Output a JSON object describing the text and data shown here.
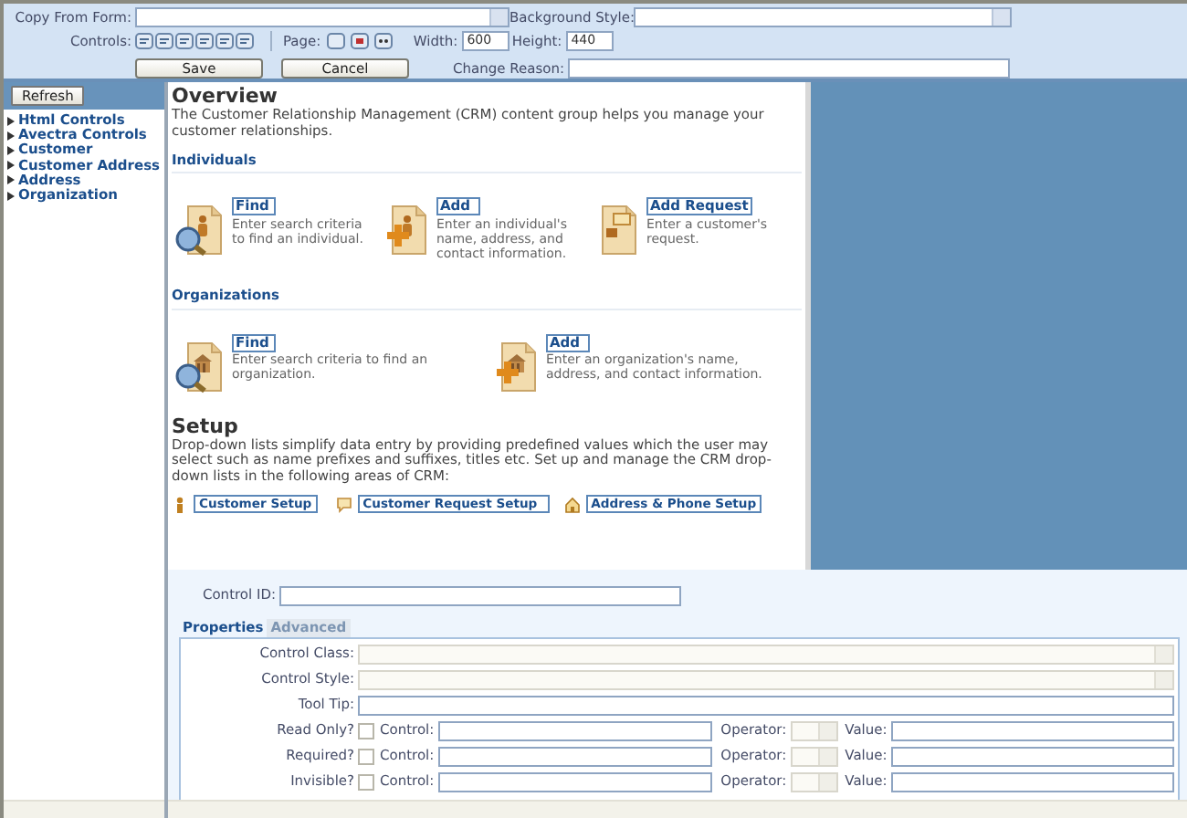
{
  "toolbar": {
    "copy_from_form": {
      "label": "Copy From Form:"
    },
    "background_style": {
      "label": "Background Style:"
    },
    "controls": {
      "label": "Controls:"
    },
    "page": {
      "label": "Page:"
    },
    "width": {
      "label": "Width:",
      "value": "600"
    },
    "height": {
      "label": "Height:",
      "value": "440"
    },
    "buttons": [
      "Save",
      "Cancel"
    ],
    "change_reason": {
      "label": "Change Reason:"
    }
  },
  "sidebar": {
    "refresh": "Refresh",
    "items": [
      "Html Controls",
      "Avectra Controls",
      "Customer",
      "Customer Address",
      "Address",
      "Organization"
    ]
  },
  "canvas": {
    "title": "Overview",
    "intro": "The Customer Relationship Management (CRM) content group helps you manage your customer relationships.",
    "sections": [
      {
        "heading": "Individuals",
        "actions": [
          {
            "kind": "find",
            "link": "Find",
            "description": "Enter search criteria to find an individual."
          },
          {
            "kind": "add",
            "link": "Add",
            "description": "Enter an individual's name, address, and contact information."
          },
          {
            "kind": "request",
            "link": "Add Request",
            "description": "Enter a customer's request."
          }
        ]
      },
      {
        "heading": "Organizations",
        "actions": [
          {
            "kind": "find",
            "link": "Find",
            "description": "Enter search criteria to find an organization."
          },
          {
            "kind": "add",
            "link": "Add",
            "description": "Enter an organization's name, address, and contact information."
          }
        ]
      }
    ],
    "setup": {
      "title": "Setup",
      "text": "Drop-down lists simplify data entry by providing predefined values which the user may select such as name prefixes and suffixes, titles etc. Set up and manage the CRM drop-down lists in the following areas of CRM:",
      "links": [
        {
          "kind": "customer",
          "label": "Customer Setup"
        },
        {
          "kind": "request",
          "label": "Customer Request Setup"
        },
        {
          "kind": "address",
          "label": "Address & Phone Setup"
        }
      ]
    }
  },
  "properties": {
    "control_id": {
      "label": "Control ID:"
    },
    "tabs": [
      {
        "label": "Properties",
        "selected": true
      },
      {
        "label": "Advanced",
        "selected": false
      }
    ],
    "rows": [
      {
        "kind": "select",
        "label": "Control Class:"
      },
      {
        "kind": "select",
        "label": "Control Style:"
      },
      {
        "kind": "text",
        "label": "Tool Tip:"
      },
      {
        "kind": "condition",
        "label": "Read Only?",
        "checked": false,
        "control": "Control:",
        "operator": "Operator:",
        "value": "Value:"
      },
      {
        "kind": "condition",
        "label": "Required?",
        "checked": false,
        "control": "Control:",
        "operator": "Operator:",
        "value": "Value:"
      },
      {
        "kind": "condition",
        "label": "Invisible?",
        "checked": false,
        "control": "Control:",
        "operator": "Operator:",
        "value": "Value:"
      }
    ]
  }
}
